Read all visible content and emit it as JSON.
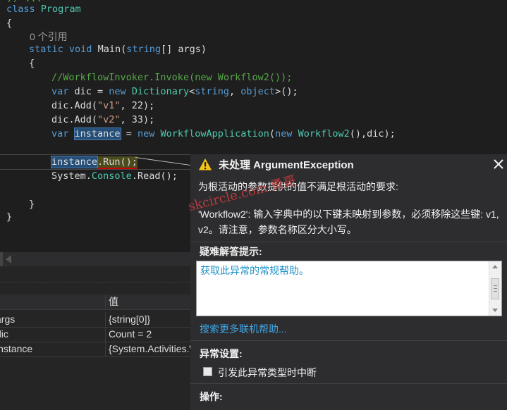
{
  "code": {
    "top_fragment": "// ...",
    "line_class": {
      "kw": "class",
      "name": "Program"
    },
    "open_brace_1": "{",
    "ref_count": "0 个引用",
    "main_sig": {
      "kw1": "static",
      "kw2": "void",
      "name": "Main(",
      "kw3": "string",
      "rest": "[] args)"
    },
    "open_brace_2": "{",
    "comment": "//WorkflowInvoker.Invoke(new Workflow2());",
    "dic_decl": {
      "kw": "var",
      "p1": " dic = ",
      "kw2": "new",
      "type1": "Dictionary",
      "p2": "<",
      "kw3": "string",
      "p3": ", ",
      "kw4": "object",
      "p4": ">();"
    },
    "add1": {
      "p1": "dic.Add(",
      "str": "\"v1\"",
      "p2": ", 22);"
    },
    "add2": {
      "p1": "dic.Add(",
      "str": "\"v2\"",
      "p2": ", 33);"
    },
    "inst_decl": {
      "kw": "var",
      "var": "instance",
      "p1": " = ",
      "kw2": "new",
      "type1": "WorkflowApplication",
      "p2": "(",
      "kw3": "new",
      "type2": "Workflow2",
      "p3": "(),dic);"
    },
    "run_line": {
      "var": "instance",
      "rest": ".Run();"
    },
    "console_line": {
      "p1": "System.",
      "type1": "Console",
      "p2": ".Read();"
    },
    "close_brace_2": "}",
    "close_brace_1": "}"
  },
  "locals": {
    "value_header": "值",
    "rows": [
      {
        "name": "args",
        "value": "{string[0]}"
      },
      {
        "name": "dic",
        "value": "Count = 2"
      },
      {
        "name": "instance",
        "value": "{System.Activities.WorkflowApplication}"
      }
    ]
  },
  "exception": {
    "title": "未处理 ArgumentException",
    "message1": "为根活动的参数提供的值不满足根活动的要求:",
    "message2": "'Workflow2': 输入字典中的以下键未映射到参数，必须移除这些键: v1, v2。请注意，参数名称区分大小写。",
    "troubleshoot_title": "疑难解答提示:",
    "tip": "获取此异常的常规帮助。",
    "more_help_link": "搜索更多联机帮助...",
    "settings_title": "异常设置:",
    "break_checkbox_label": "引发此异常类型时中断",
    "actions_title": "操作:"
  },
  "watermark": "skcircle.com 勇哥",
  "colors": {
    "accent_link": "#3ea6e6",
    "keyword": "#569cd6",
    "type": "#4ec9b0",
    "string": "#d69d85",
    "comment": "#57a64a"
  }
}
